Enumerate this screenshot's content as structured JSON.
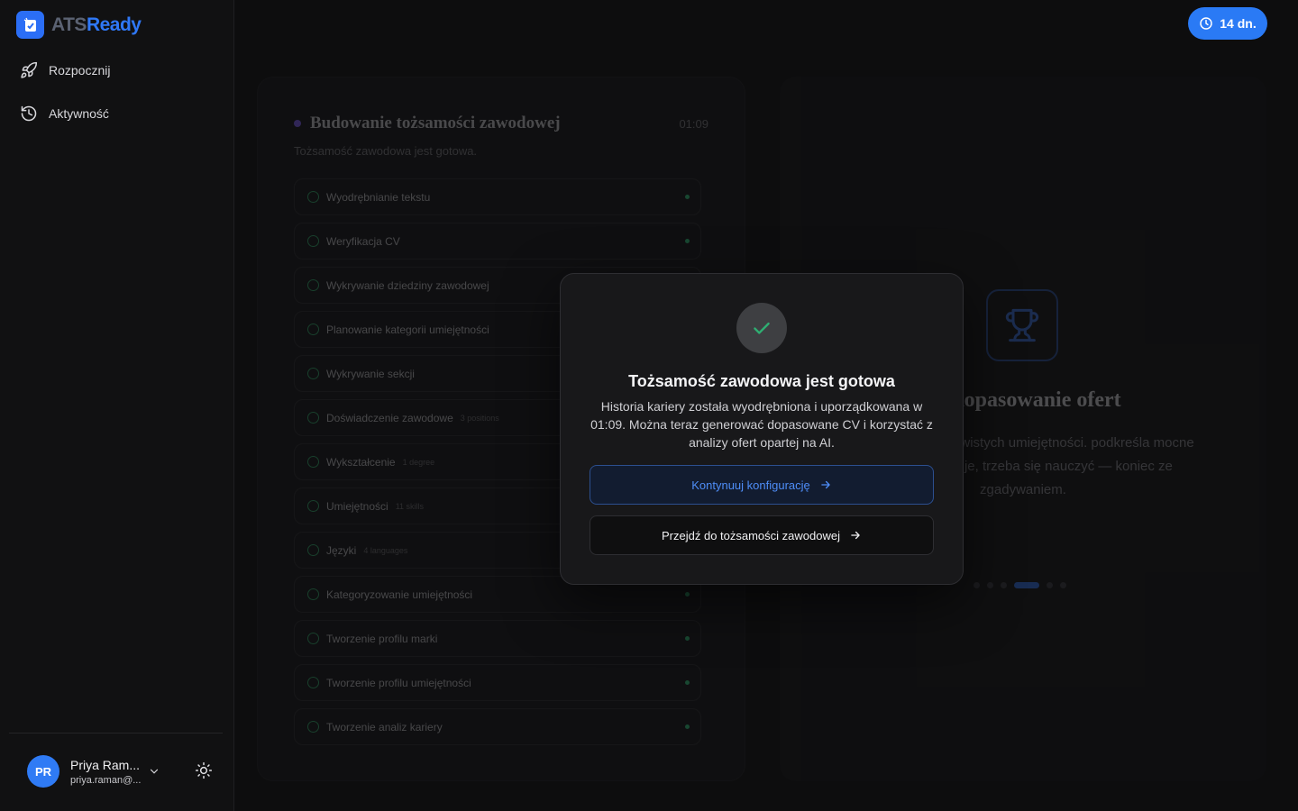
{
  "brand": {
    "name_part1": "ATS",
    "name_part2": "Ready",
    "accent": "#2b6ef5"
  },
  "nav": {
    "items": [
      {
        "label": "Rozpocznij",
        "icon": "rocket-icon"
      },
      {
        "label": "Aktywność",
        "icon": "history-icon"
      }
    ]
  },
  "user": {
    "initials": "PR",
    "name": "Priya Ram...",
    "email": "priya.raman@..."
  },
  "trial": {
    "label": "14 dn."
  },
  "progress_panel": {
    "title": "Budowanie tożsamości zawodowej",
    "time": "01:09",
    "subtitle": "Tożsamość zawodowa jest gotowa.",
    "steps": [
      {
        "label": "Wyodrębnianie tekstu",
        "meta": ""
      },
      {
        "label": "Weryfikacja CV",
        "meta": ""
      },
      {
        "label": "Wykrywanie dziedziny zawodowej",
        "meta": ""
      },
      {
        "label": "Planowanie kategorii umiejętności",
        "meta": ""
      },
      {
        "label": "Wykrywanie sekcji",
        "meta": ""
      },
      {
        "label": "Doświadczenie zawodowe",
        "meta": "3 positions"
      },
      {
        "label": "Wykształcenie",
        "meta": "1 degree"
      },
      {
        "label": "Umiejętności",
        "meta": "11 skills"
      },
      {
        "label": "Języki",
        "meta": "4 languages"
      },
      {
        "label": "Kategoryzowanie umiejętności",
        "meta": ""
      },
      {
        "label": "Tworzenie profilu marki",
        "meta": ""
      },
      {
        "label": "Tworzenie profilu umiejętności",
        "meta": ""
      },
      {
        "label": "Tworzenie analiz kariery",
        "meta": ""
      }
    ]
  },
  "feature_panel": {
    "title": "ne dopasowanie ofert",
    "body": "asujące do rzeczywistych umiejętności. podkreśla mocne strony i pokazuje, trzeba się nauczyć — koniec ze zgadywaniem."
  },
  "modal": {
    "title": "Tożsamość zawodowa jest gotowa",
    "text": "Historia kariery została wyodrębniona i uporządkowana w 01:09. Można teraz generować dopasowane CV i korzystać z analizy ofert opartej na AI.",
    "primary_label": "Kontynuuj konfigurację",
    "secondary_label": "Przejdź do tożsamości zawodowej"
  }
}
